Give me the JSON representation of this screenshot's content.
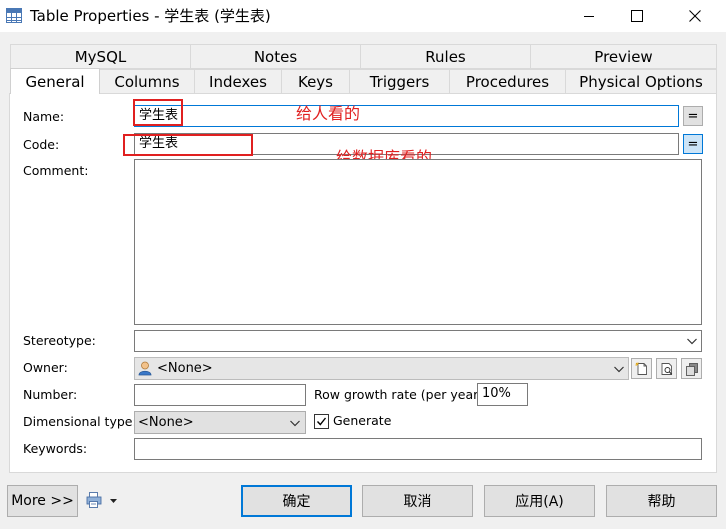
{
  "window": {
    "title": "Table Properties - 学生表 (学生表)"
  },
  "tabs_row1": [
    {
      "label": "MySQL"
    },
    {
      "label": "Notes"
    },
    {
      "label": "Rules"
    },
    {
      "label": "Preview"
    }
  ],
  "tabs_row2": [
    {
      "label": "General",
      "active": true
    },
    {
      "label": "Columns"
    },
    {
      "label": "Indexes"
    },
    {
      "label": "Keys"
    },
    {
      "label": "Triggers"
    },
    {
      "label": "Procedures"
    },
    {
      "label": "Physical Options"
    }
  ],
  "form": {
    "name_label": "Name:",
    "name_value": "学生表",
    "code_label": "Code:",
    "code_value": "学生表",
    "equals_label": "=",
    "comment_label": "Comment:",
    "comment_value": "",
    "stereotype_label": "Stereotype:",
    "stereotype_value": "",
    "owner_label": "Owner:",
    "owner_value": "<None>",
    "number_label": "Number:",
    "number_value": "",
    "row_growth_label": "Row growth rate (per year):",
    "row_growth_value": "10%",
    "dimensional_label": "Dimensional type:",
    "dimensional_value": "<None>",
    "generate_label": "Generate",
    "generate_checked": true,
    "keywords_label": "Keywords:",
    "keywords_value": ""
  },
  "annotations": {
    "name_note": "给人看的",
    "code_note": "给数据库看的",
    "color": "#e02020"
  },
  "footer": {
    "more_label": "More >>",
    "ok_label": "确定",
    "cancel_label": "取消",
    "apply_label": "应用(A)",
    "help_label": "帮助"
  },
  "colors": {
    "accent": "#0078d7",
    "annotation": "#e02020"
  }
}
